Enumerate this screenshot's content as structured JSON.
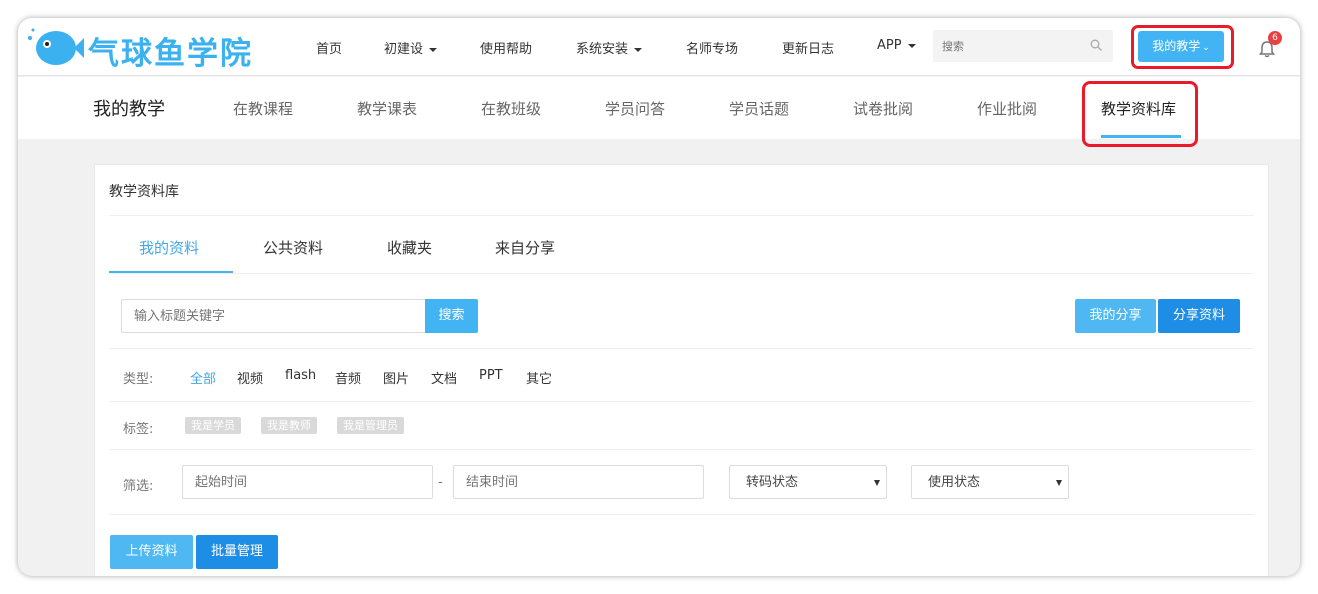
{
  "logo": {
    "text": "气球鱼学院",
    "icon": "balloon-fish-icon"
  },
  "topnav": {
    "items": [
      {
        "label": "首页"
      },
      {
        "label": "初建设"
      },
      {
        "label": "使用帮助"
      },
      {
        "label": "系统安装"
      },
      {
        "label": "名师专场"
      },
      {
        "label": "更新日志"
      },
      {
        "label": "APP"
      }
    ],
    "search_placeholder": "搜索",
    "my_teaching_button": "我的教学",
    "notification_count": "6"
  },
  "subnav": {
    "title": "我的教学",
    "items": [
      {
        "label": "在教课程"
      },
      {
        "label": "教学课表"
      },
      {
        "label": "在教班级"
      },
      {
        "label": "学员问答"
      },
      {
        "label": "学员话题"
      },
      {
        "label": "试卷批阅"
      },
      {
        "label": "作业批阅"
      },
      {
        "label": "教学资料库"
      }
    ]
  },
  "panel": {
    "title": "教学资料库",
    "tabs": [
      {
        "label": "我的资料"
      },
      {
        "label": "公共资料"
      },
      {
        "label": "收藏夹"
      },
      {
        "label": "来自分享"
      }
    ],
    "keyword_placeholder": "输入标题关键字",
    "search_button": "搜索",
    "my_share_button": "我的分享",
    "share_button": "分享资料",
    "type_label": "类型:",
    "types": [
      "全部",
      "视频",
      "flash",
      "音频",
      "图片",
      "文档",
      "PPT",
      "其它"
    ],
    "tag_label": "标签:",
    "tags": [
      "我是学员",
      "我是教师",
      "我是管理员"
    ],
    "filter_label": "筛选:",
    "start_time_placeholder": "起始时间",
    "dash": "-",
    "end_time_placeholder": "结束时间",
    "transcode_select": "转码状态",
    "usage_select": "使用状态",
    "upload_button": "上传资料",
    "batch_button": "批量管理"
  },
  "colors": {
    "accent": "#43b4f3",
    "primary": "#1e8de6",
    "highlight": "#ea1a2b"
  }
}
